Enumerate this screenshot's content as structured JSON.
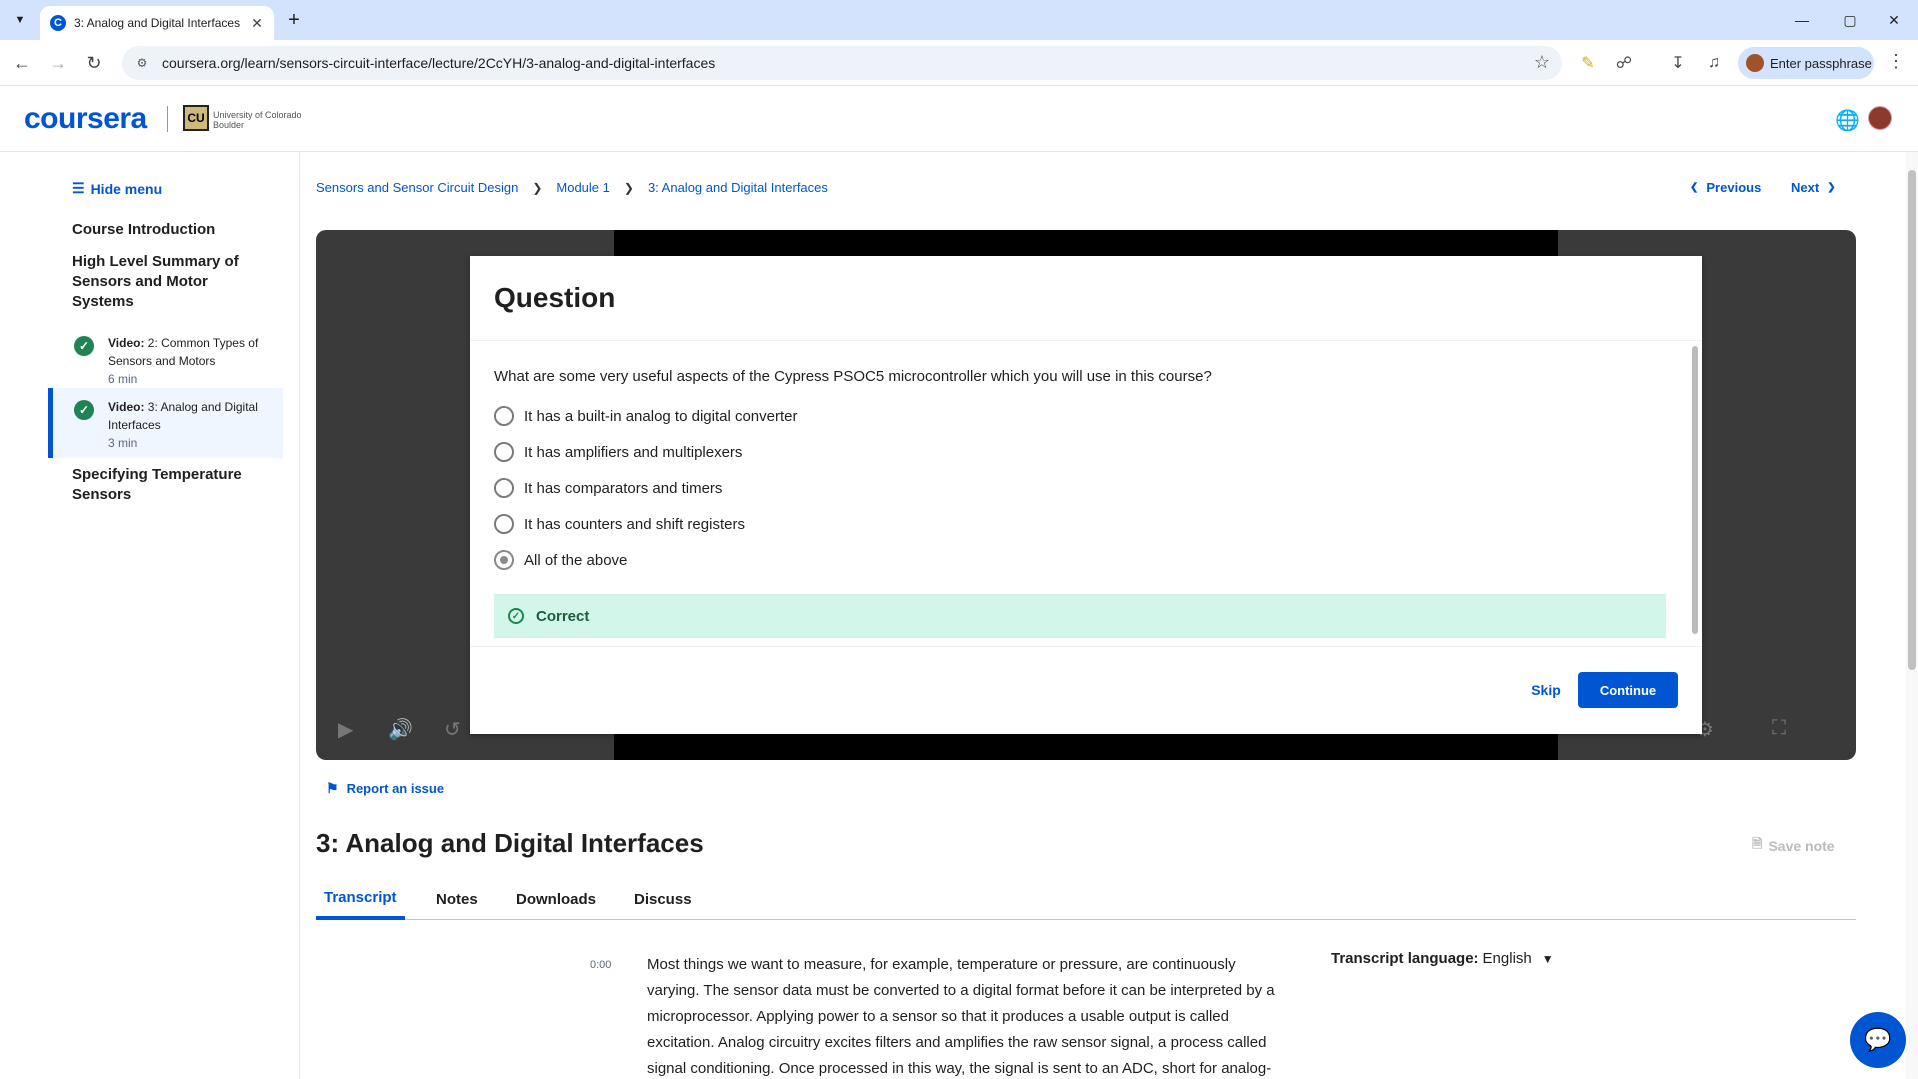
{
  "browser": {
    "tab_title": "3: Analog and Digital Interfaces",
    "url": "coursera.org/learn/sensors-circuit-interface/lecture/2CcYH/3-analog-and-digital-interfaces",
    "profile_label": "Enter passphrase"
  },
  "header": {
    "logo_text": "coursera",
    "partner_logo_text": "University of Colorado Boulder"
  },
  "sidebar": {
    "hide_menu_label": "Hide menu",
    "sections": [
      {
        "title": "Course Introduction"
      },
      {
        "title": "High Level Summary of Sensors and Motor Systems"
      },
      {
        "title": "Specifying Temperature Sensors"
      }
    ],
    "items": [
      {
        "type": "Video:",
        "title": "2: Common Types of Sensors and Motors",
        "duration": "6 min"
      },
      {
        "type": "Video:",
        "title": "3: Analog and Digital Interfaces",
        "duration": "3 min"
      }
    ]
  },
  "breadcrumb": {
    "course": "Sensors and Sensor Circuit Design",
    "module": "Module 1",
    "lecture": "3: Analog and Digital Interfaces"
  },
  "navigation": {
    "previous_label": "Previous",
    "next_label": "Next"
  },
  "quiz": {
    "heading": "Question",
    "question": "What are some very useful aspects of the Cypress PSOC5 microcontroller which you will use in this course?",
    "options": [
      "It has a built-in analog to digital converter",
      "It has amplifiers and multiplexers",
      "It has comparators and timers",
      "It has counters and shift registers",
      "All of the above"
    ],
    "selected_index": 4,
    "feedback": "Correct",
    "skip_label": "Skip",
    "continue_label": "Continue"
  },
  "lecture": {
    "report_label": "Report an issue",
    "title": "3: Analog and Digital Interfaces",
    "save_note_label": "Save note",
    "tabs": [
      "Transcript",
      "Notes",
      "Downloads",
      "Discuss"
    ],
    "active_tab": "Transcript"
  },
  "transcript": {
    "timestamp": "0:00",
    "text": "Most things we want to measure, for example, temperature or pressure, are continuously varying. The sensor data must be converted to a digital format before it can be interpreted by a microprocessor. Applying power to a sensor so that it produces a usable output is called excitation. Analog circuitry excites filters and amplifies the raw sensor signal, a process called signal conditioning. Once processed in this way, the signal is sent to an ADC, short for analog-to-",
    "language_label": "Transcript language:",
    "language_value": "English"
  },
  "colors": {
    "brand": "#0056d2",
    "success": "#1f8354",
    "correct_bg": "#d2f7ea"
  }
}
